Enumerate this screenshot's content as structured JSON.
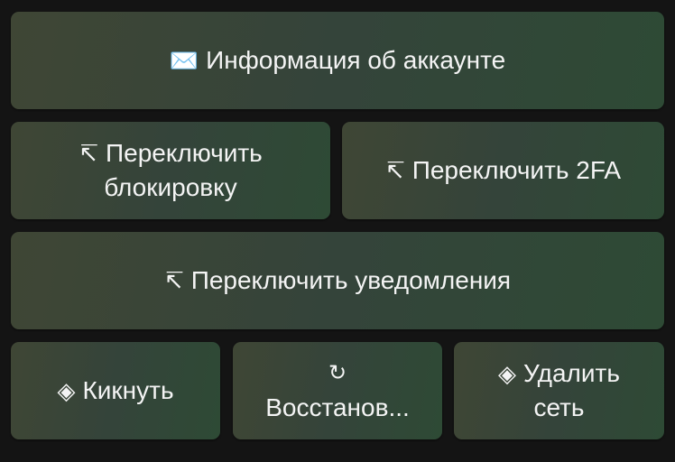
{
  "keyboard": {
    "account_info": {
      "icon": "envelope-icon",
      "glyph": "✉️",
      "label": "Информация об аккаунте"
    },
    "toggle_block": {
      "icon": "arrow-up-left-bar-icon",
      "glyph": "↸",
      "label_line1": "Переключить",
      "label_line2": "блокировку"
    },
    "toggle_2fa": {
      "icon": "arrow-up-left-bar-icon",
      "glyph": "↸",
      "label": "Переключить 2FA"
    },
    "toggle_notifications": {
      "icon": "arrow-up-left-bar-icon",
      "glyph": "↸",
      "label": "Переключить уведомления"
    },
    "kick": {
      "icon": "diamond-icon",
      "glyph": "◈",
      "label": "Кикнуть"
    },
    "restore": {
      "icon": "restore-arrow-icon",
      "glyph": "↻",
      "label": "Восстанов..."
    },
    "delete_network": {
      "icon": "diamond-icon",
      "glyph": "◈",
      "label_line1": "Удалить",
      "label_line2": "сеть"
    }
  },
  "colors": {
    "background": "#141414",
    "button_start": "#3f4635",
    "button_end": "#2e4a35",
    "text": "#f4f4f4"
  }
}
